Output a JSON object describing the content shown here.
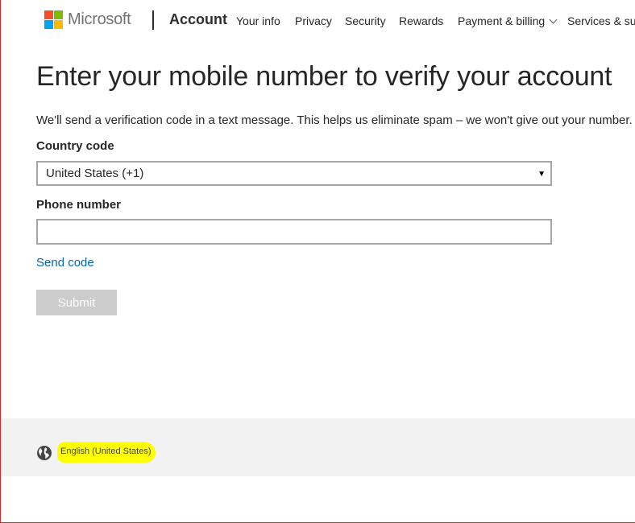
{
  "header": {
    "brand": "Microsoft",
    "section": "Account",
    "nav": [
      {
        "label": "Your info"
      },
      {
        "label": "Privacy"
      },
      {
        "label": "Security"
      },
      {
        "label": "Rewards"
      },
      {
        "label": "Payment & billing"
      },
      {
        "label": "Services & sub"
      }
    ]
  },
  "main": {
    "title": "Enter your mobile number to verify your account",
    "description": "We'll send a verification code in a text message. This helps us eliminate spam – we won't give out your number. T",
    "country_label": "Country code",
    "country_value": "United States (+1)",
    "phone_label": "Phone number",
    "phone_value": "",
    "send_code": "Send code",
    "submit": "Submit"
  },
  "footer": {
    "language": "English (United States)"
  },
  "colors": {
    "link": "#0067b8",
    "disabled_button": "#cccccc",
    "footer_bg": "#f2f2f2",
    "highlight": "#ffff00"
  },
  "icons": [
    "microsoft-logo-icon",
    "chevron-down-icon",
    "select-arrow-icon",
    "globe-icon"
  ]
}
